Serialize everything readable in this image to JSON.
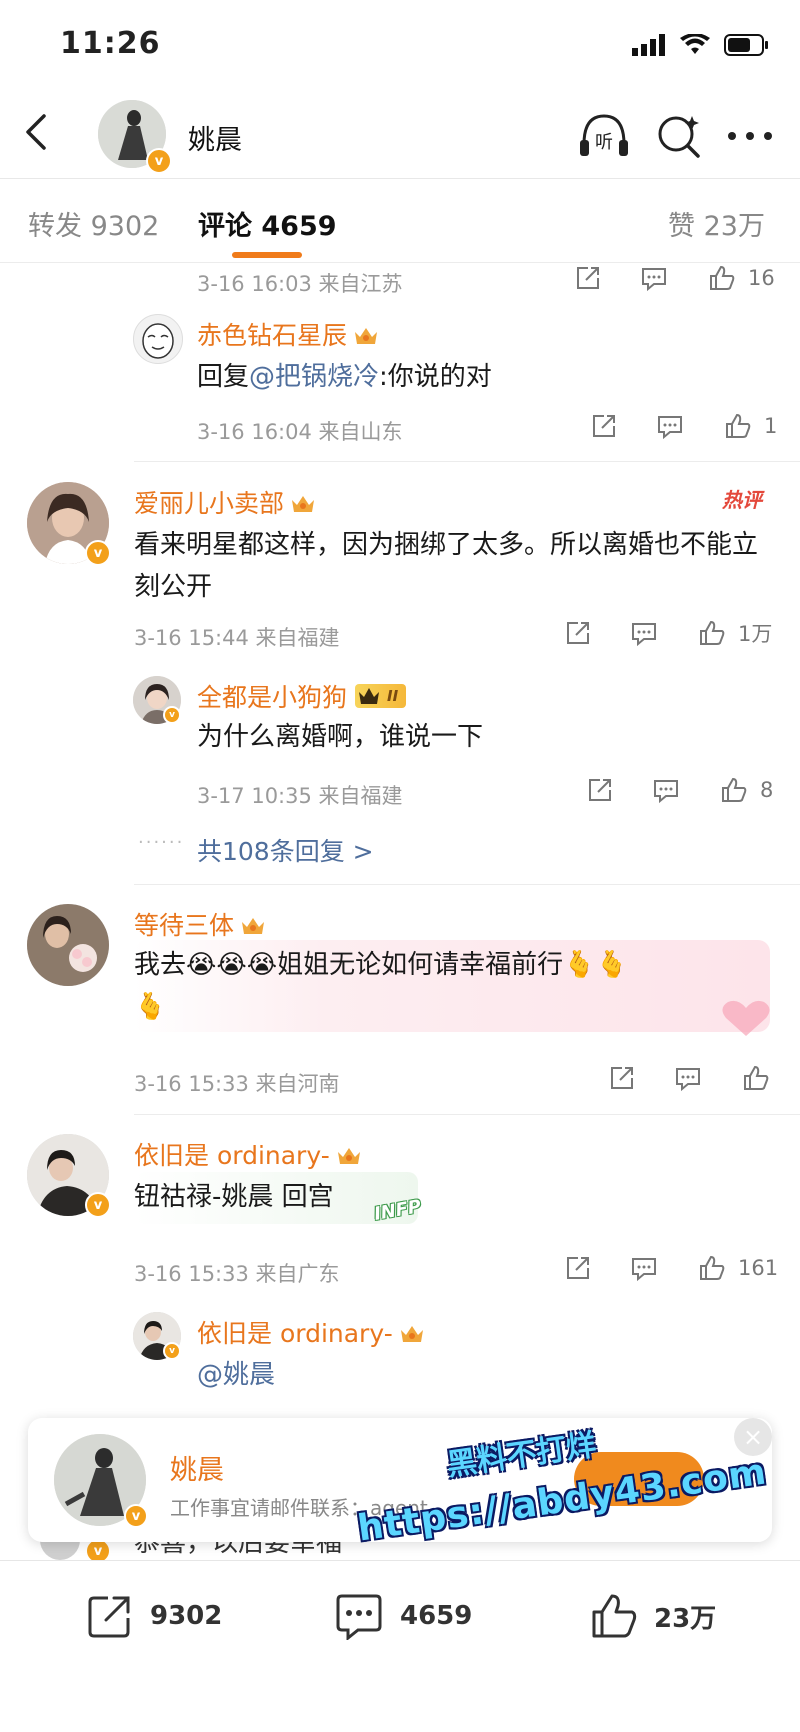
{
  "status_bar": {
    "time": "11:26"
  },
  "header": {
    "title": "姚晨"
  },
  "tabs": {
    "repost": "转发 9302",
    "comment": "评论 4659",
    "like": "赞 23万"
  },
  "comments": [
    {
      "meta": "3-16 16:03  来自江苏",
      "like_count": "16",
      "sub": {
        "name": "赤色钻石星辰",
        "reply_prefix": "回复",
        "mention": "@把锅烧冷",
        "text": ":你说的对",
        "meta": "3-16 16:04  来自山东",
        "like_count": "1"
      }
    },
    {
      "name": "爱丽儿小卖部",
      "hot_badge": "热评",
      "text": "看来明星都这样，因为捆绑了太多。所以离婚也不能立刻公开",
      "meta": "3-16 15:44  来自福建",
      "like_count": "1万",
      "sub": {
        "name": "全都是小狗狗",
        "level_badge": "II",
        "text": "为什么离婚啊，谁说一下",
        "meta": "3-17 10:35  来自福建",
        "like_count": "8"
      },
      "more_replies": "共108条回复 >"
    },
    {
      "name": "等待三体",
      "text_line1": "我去😭😭😭姐姐无论如何请幸福前行🫰🫰",
      "text_line2": "🫰",
      "meta": "3-16 15:33  来自河南",
      "like_count": ""
    },
    {
      "name": "依旧是 ordinary-",
      "text": "钮祜禄-姚晨 回宫",
      "sticker_text": "INFP",
      "meta": "3-16 15:33  来自广东",
      "like_count": "161",
      "sub": {
        "name": "依旧是 ordinary-",
        "mention": "@姚晨"
      }
    },
    {
      "partial_text": "恭喜，以后要幸福"
    }
  ],
  "popup": {
    "name": "姚晨",
    "desc": "工作事宜请邮件联系：agent"
  },
  "watermark": {
    "line1": "黑料不打烊",
    "line2": "https://abdy43.com"
  },
  "bottom_bar": {
    "repost_count": "9302",
    "comment_count": "4659",
    "like_count": "23万"
  },
  "colors": {
    "accent": "#f07b1a",
    "name": "#e8761d",
    "link": "#4f6e9c"
  }
}
